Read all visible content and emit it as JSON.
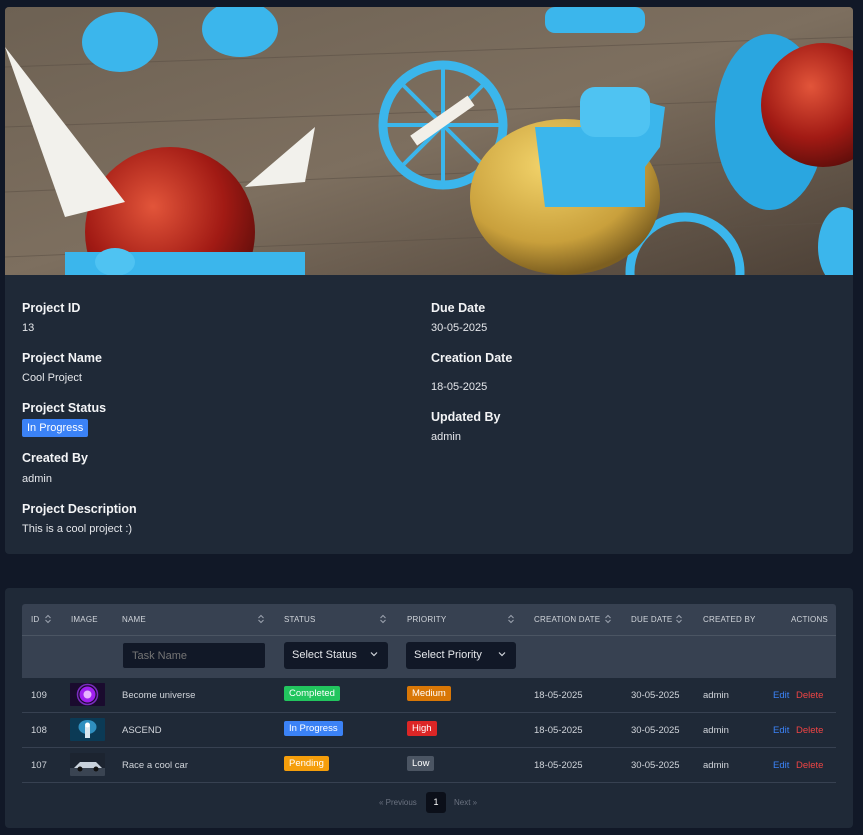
{
  "project": {
    "labels": {
      "id": "Project ID",
      "name": "Project Name",
      "status": "Project Status",
      "created_by": "Created By",
      "description": "Project Description",
      "due_date": "Due Date",
      "creation_date": "Creation Date",
      "updated_by": "Updated By"
    },
    "id": "13",
    "name": "Cool Project",
    "status": "In Progress",
    "created_by": "admin",
    "description": "This is a cool project :)",
    "due_date": "30-05-2025",
    "creation_date": "18-05-2025",
    "updated_by": "admin"
  },
  "tasks_table": {
    "columns": {
      "id": "ID",
      "image": "IMAGE",
      "name": "NAME",
      "status": "STATUS",
      "priority": "PRIORITY",
      "creation_date": "CREATION DATE",
      "due_date": "DUE DATE",
      "created_by": "CREATED BY",
      "actions": "ACTIONS"
    },
    "filters": {
      "name_placeholder": "Task Name",
      "status_select": "Select Status",
      "priority_select": "Select Priority"
    },
    "rows": [
      {
        "id": "109",
        "image": "purple-cosmic-thumbnail",
        "name": "Become universe",
        "status": "Completed",
        "priority": "Medium",
        "creation_date": "18-05-2025",
        "due_date": "30-05-2025",
        "created_by": "admin",
        "edit": "Edit",
        "delete": "Delete"
      },
      {
        "id": "108",
        "image": "blue-figure-thumbnail",
        "name": "ASCEND",
        "status": "In Progress",
        "priority": "High",
        "creation_date": "18-05-2025",
        "due_date": "30-05-2025",
        "created_by": "admin",
        "edit": "Edit",
        "delete": "Delete"
      },
      {
        "id": "107",
        "image": "race-car-thumbnail",
        "name": "Race a cool car",
        "status": "Pending",
        "priority": "Low",
        "creation_date": "18-05-2025",
        "due_date": "30-05-2025",
        "created_by": "admin",
        "edit": "Edit",
        "delete": "Delete"
      }
    ],
    "pagination": {
      "previous": "« Previous",
      "current_page": "1",
      "next": "Next »"
    }
  },
  "colors": {
    "page_bg": "#111827",
    "card_bg": "#1f2937",
    "table_header_bg": "#374151",
    "status_completed": "#22c55e",
    "status_in_progress": "#3b82f6",
    "status_pending": "#f59e0b",
    "priority_medium": "#d97706",
    "priority_high": "#dc2626",
    "priority_low": "#4b5563",
    "edit_link": "#3b82f6",
    "delete_link": "#ef4444"
  }
}
